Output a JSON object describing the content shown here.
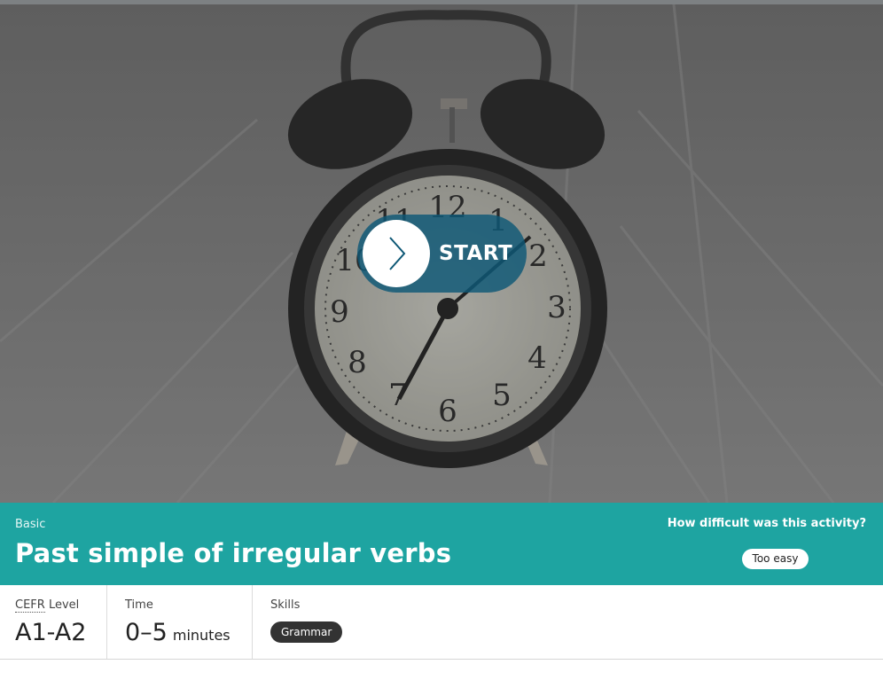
{
  "activity": {
    "start_label": "START",
    "level_tag": "Basic",
    "title": "Past simple of irregular verbs",
    "difficulty_question": "How difficult was this activity?",
    "difficulty_option": "Too easy"
  },
  "info": {
    "cefr": {
      "label_abbr": "CEFR",
      "label_rest": " Level",
      "value": "A1-A2"
    },
    "time": {
      "label": "Time",
      "value": "0–5",
      "unit": "minutes"
    },
    "skills": {
      "label": "Skills",
      "chips": [
        "Grammar"
      ]
    }
  },
  "clock_numerals": [
    "12",
    "1",
    "2",
    "3",
    "4",
    "5",
    "6",
    "7",
    "8",
    "9",
    "10",
    "11"
  ],
  "colors": {
    "banner": "#1ea4a1",
    "start_button": "#0e5876",
    "chip": "#333333"
  },
  "icons": {
    "start": "chevron-right-icon"
  }
}
